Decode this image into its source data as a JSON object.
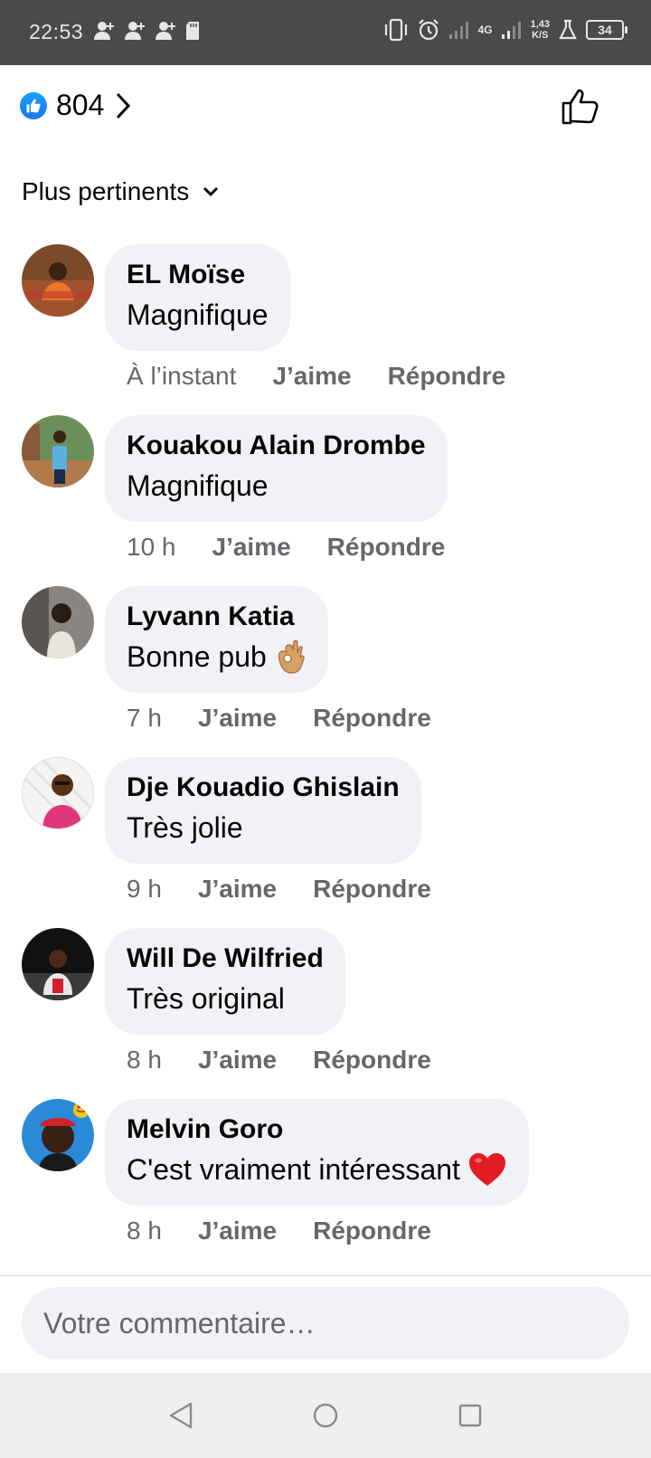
{
  "status_bar": {
    "time": "22:53",
    "network": "4G",
    "speed_value": "1,43",
    "speed_unit": "K/S",
    "battery": "34"
  },
  "reactions": {
    "count": "804",
    "like_color": "#1877f2"
  },
  "sort": {
    "label": "Plus pertinents"
  },
  "comments": [
    {
      "name": "EL Moïse",
      "text": "Magnifique",
      "emoji": "",
      "time": "À l’instant",
      "like_label": "J’aime",
      "reply_label": "Répondre"
    },
    {
      "name": "Kouakou Alain Drombe",
      "text": "Magnifique",
      "emoji": "",
      "time": "10 h",
      "like_label": "J’aime",
      "reply_label": "Répondre"
    },
    {
      "name": "Lyvann Katia",
      "text": "Bonne pub",
      "emoji": "ok-hand-icon",
      "time": "7 h",
      "like_label": "J’aime",
      "reply_label": "Répondre"
    },
    {
      "name": "Dje Kouadio Ghislain",
      "text": "Très jolie",
      "emoji": "",
      "time": "9 h",
      "like_label": "J’aime",
      "reply_label": "Répondre"
    },
    {
      "name": "Will De Wilfried",
      "text": "Très original",
      "emoji": "",
      "time": "8 h",
      "like_label": "J’aime",
      "reply_label": "Répondre"
    },
    {
      "name": "Melvin Goro",
      "text": "C'est vraiment intéressant",
      "emoji": "red-heart-icon",
      "time": "8 h",
      "like_label": "J’aime",
      "reply_label": "Répondre"
    }
  ],
  "composer": {
    "placeholder": "Votre commentaire…"
  },
  "colors": {
    "bubble": "#f0f2f5",
    "meta_text": "#65676b",
    "status_bar": "#4a4a4a"
  }
}
